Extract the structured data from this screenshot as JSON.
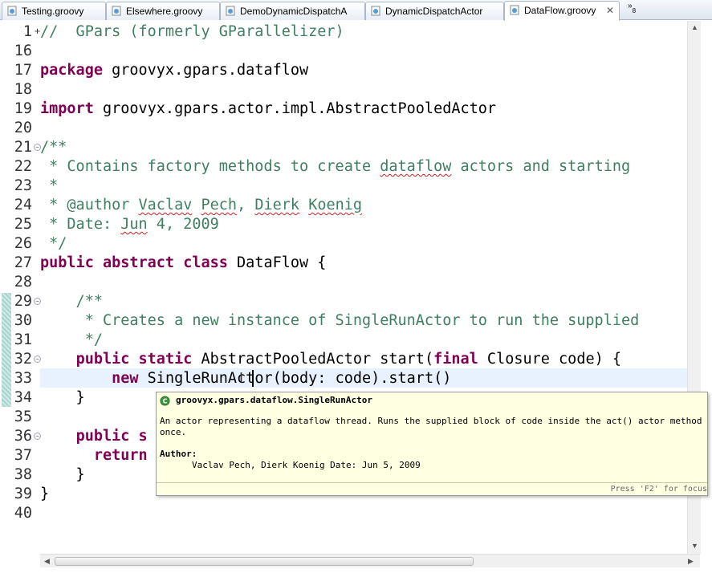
{
  "tabs": [
    {
      "label": "Testing.groovy",
      "active": false
    },
    {
      "label": "Elsewhere.groovy",
      "active": false
    },
    {
      "label": "DemoDynamicDispatchA",
      "active": false
    },
    {
      "label": "DynamicDispatchActor",
      "active": false
    },
    {
      "label": "DataFlow.groovy",
      "active": true
    }
  ],
  "tab_overflow": {
    "symbol": "»",
    "count": "8"
  },
  "line_numbers": [
    "1",
    "16",
    "17",
    "18",
    "19",
    "20",
    "21",
    "22",
    "23",
    "24",
    "25",
    "26",
    "27",
    "28",
    "29",
    "30",
    "31",
    "32",
    "33",
    "34",
    "35",
    "36",
    "37",
    "38",
    "39",
    "40"
  ],
  "code": {
    "l1_comment": "//  GPars (formerly GParallelizer)",
    "l17_kw": "package",
    "l17_rest": " groovyx.gpars.dataflow",
    "l19_kw": "import",
    "l19_rest": " groovyx.gpars.actor.impl.AbstractPooledActor",
    "l21": "/**",
    "l22_a": " * Contains factory methods to create ",
    "l22_b": "dataflow",
    "l22_c": " actors and starting",
    "l23": " *",
    "l24_a": " * @author ",
    "l24_b": "Vaclav",
    "l24_c": " ",
    "l24_d": "Pech",
    "l24_e": ", ",
    "l24_f": "Dierk",
    "l24_g": " ",
    "l24_h": "Koenig",
    "l25_a": " * Date: ",
    "l25_b": "Jun",
    "l25_c": " 4, 2009",
    "l26": " */",
    "l27_kw": "public abstract class",
    "l27_rest": " DataFlow {",
    "l29": "    /**",
    "l30": "     * Creates a new instance of SingleRunActor to run the supplied",
    "l31": "     */",
    "l32_indent": "    ",
    "l32_kw1": "public static",
    "l32_mid": " AbstractPooledActor start(",
    "l32_kw2": "final",
    "l32_rest": " Closure code) {",
    "l33_indent": "        ",
    "l33_kw": "new",
    "l33_rest": " SingleRunActor(body: code).start()",
    "l34": "    }",
    "l36_indent": "    ",
    "l36_kw": "public s",
    "l37_indent": "      ",
    "l37_kw": "return",
    "l38": "    }",
    "l39": "}"
  },
  "hover": {
    "title": "groovyx.gpars.dataflow.SingleRunActor",
    "description": "An actor representing a dataflow thread. Runs the supplied block of code inside the act() actor method once.",
    "author_label": "Author:",
    "author_value": "Vaclav Pech, Dierk Koenig Date: Jun 5, 2009",
    "hint": "Press 'F2' for focus"
  }
}
